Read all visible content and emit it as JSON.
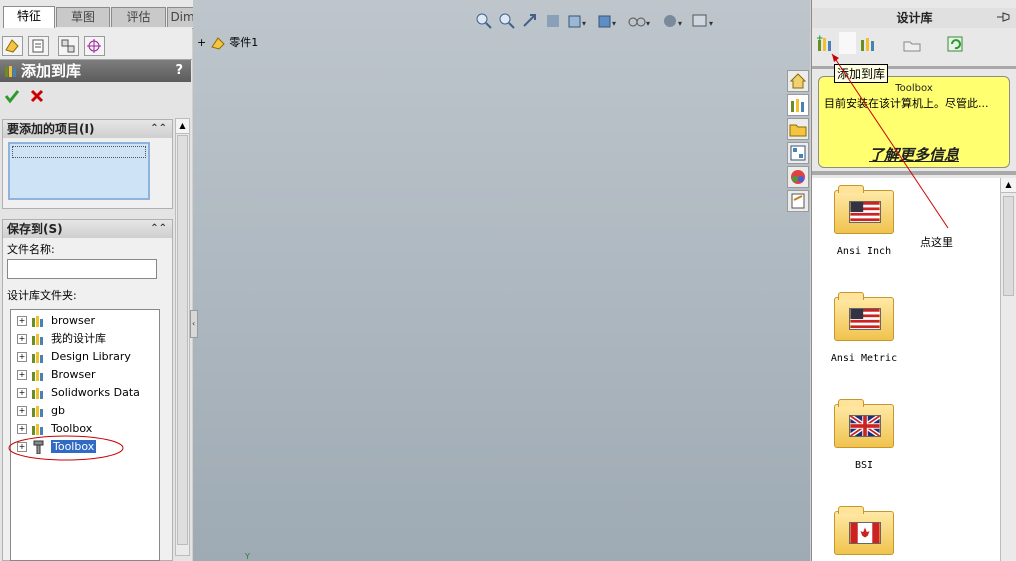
{
  "tabs": [
    "特征",
    "草图",
    "评估",
    "DimXpert"
  ],
  "property_manager": {
    "title": "添加到库",
    "help": "?",
    "group_items": {
      "label": "要添加的项目(I)"
    },
    "group_save": {
      "label": "保存到(S)"
    },
    "file_name_label": "文件名称:",
    "file_name_value": "",
    "folder_label": "设计库文件夹:",
    "tree": [
      "browser",
      "我的设计库",
      "Design Library",
      "Browser",
      "Solidworks Data",
      "gb",
      "Toolbox",
      "Toolbox"
    ],
    "selected_index": 7
  },
  "feature_tree": {
    "root": "零件1"
  },
  "axis": {
    "y_label": "Y"
  },
  "design_library": {
    "title": "设计库",
    "tooltip": "添加到库",
    "toolbox_title": "Toolbox",
    "toolbox_text": "目前安装在该计算机上。尽管此...",
    "learn_more": "了解更多信息",
    "annotation": "点这里",
    "folders": [
      "Ansi Inch",
      "Ansi Metric",
      "BSI",
      ""
    ]
  },
  "colors": {
    "accent_red": "#cc0000",
    "selection": "#316ac5",
    "info_yellow": "#ffff70"
  }
}
